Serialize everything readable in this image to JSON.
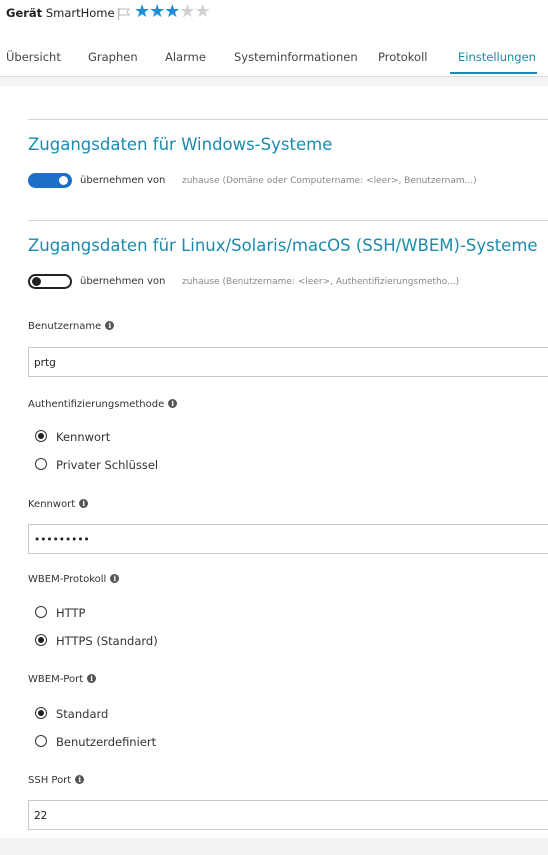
{
  "header": {
    "device_prefix": "Gerät",
    "device_name": "SmartHome",
    "rating": 3,
    "max_rating": 5,
    "flag_icon": "flag-icon"
  },
  "tabs": [
    {
      "label": "Übersicht",
      "active": false
    },
    {
      "label": "Graphen",
      "active": false
    },
    {
      "label": "Alarme",
      "active": false
    },
    {
      "label": "Systeminformationen",
      "active": false
    },
    {
      "label": "Protokoll",
      "active": false
    },
    {
      "label": "Einstellungen",
      "active": true
    }
  ],
  "windows": {
    "title": "Zugangsdaten für Windows-Systeme",
    "inherit_on": true,
    "inherit_label": "übernehmen von",
    "inherit_desc": "zuhause (Domäne oder Computername: <leer>, Benutzernam...)"
  },
  "linux": {
    "title": "Zugangsdaten für Linux/Solaris/macOS (SSH/WBEM)-Systeme",
    "inherit_on": false,
    "inherit_label": "übernehmen von",
    "inherit_desc": "zuhause (Benutzername: <leer>, Authentifizierungsmetho...)"
  },
  "fields": {
    "username": {
      "label": "Benutzername",
      "value": "prtg"
    },
    "auth_method": {
      "label": "Authentifizierungsmethode",
      "options": [
        "Kennwort",
        "Privater Schlüssel"
      ],
      "selected": 0
    },
    "password": {
      "label": "Kennwort",
      "value": "•••••••••"
    },
    "wbem_protocol": {
      "label": "WBEM-Protokoll",
      "options": [
        "HTTP",
        "HTTPS (Standard)"
      ],
      "selected": 1
    },
    "wbem_port": {
      "label": "WBEM-Port",
      "options": [
        "Standard",
        "Benutzerdefiniert"
      ],
      "selected": 0
    },
    "ssh_port": {
      "label": "SSH Port",
      "value": "22"
    }
  },
  "colors": {
    "accent": "#1a8baf",
    "toggle_on": "#1b6fc8",
    "star": "#1b8ed6"
  }
}
